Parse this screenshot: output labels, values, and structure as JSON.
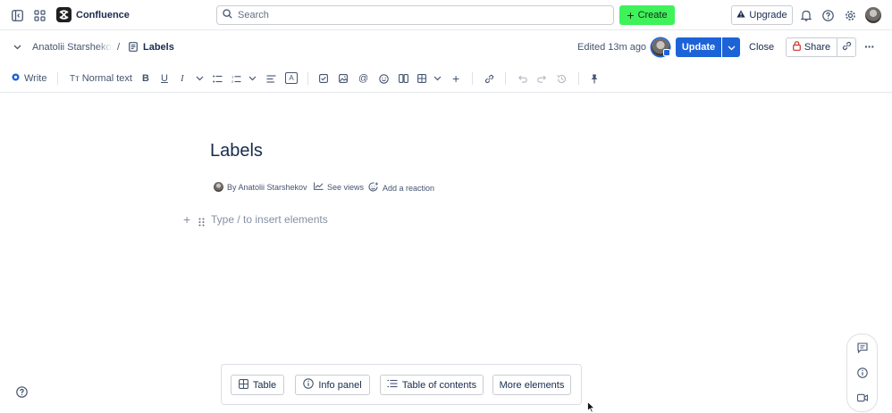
{
  "topbar": {
    "app_name": "Confluence",
    "search_placeholder": "Search",
    "create_label": "Create",
    "upgrade_label": "Upgrade",
    "icons": [
      "sidebar-toggle-icon",
      "app-switcher-icon",
      "search-icon",
      "plus-icon",
      "warning-icon",
      "bell-icon",
      "help-icon",
      "gear-icon"
    ]
  },
  "page_header": {
    "breadcrumb_space": "Anatolii Starshekov",
    "breadcrumb_separator": "/",
    "breadcrumb_page": "Labels",
    "edited": "Edited 13m ago",
    "update_label": "Update",
    "close_label": "Close",
    "share_label": "Share",
    "more_label": "···"
  },
  "toolbar": {
    "mode_label": "Write",
    "text_style_label": "Normal text",
    "text_style_prefix": "Tт",
    "bold_label": "B",
    "underline_label": "U",
    "italic_label": "I",
    "color_label": "A"
  },
  "document": {
    "title": "Labels",
    "author": "By Anatolii Starshekov",
    "see_views": "See views",
    "add_reaction": "Add a reaction",
    "placeholder": "Type / to insert elements"
  },
  "elements_bar": {
    "table": "Table",
    "info_panel": "Info panel",
    "table_of_contents": "Table of contents",
    "more_elements": "More elements"
  },
  "colors": {
    "create_green": "#3ff25a",
    "update_blue": "#1d63d8",
    "text_primary": "#172b4d",
    "text_subtle": "#44546f"
  }
}
